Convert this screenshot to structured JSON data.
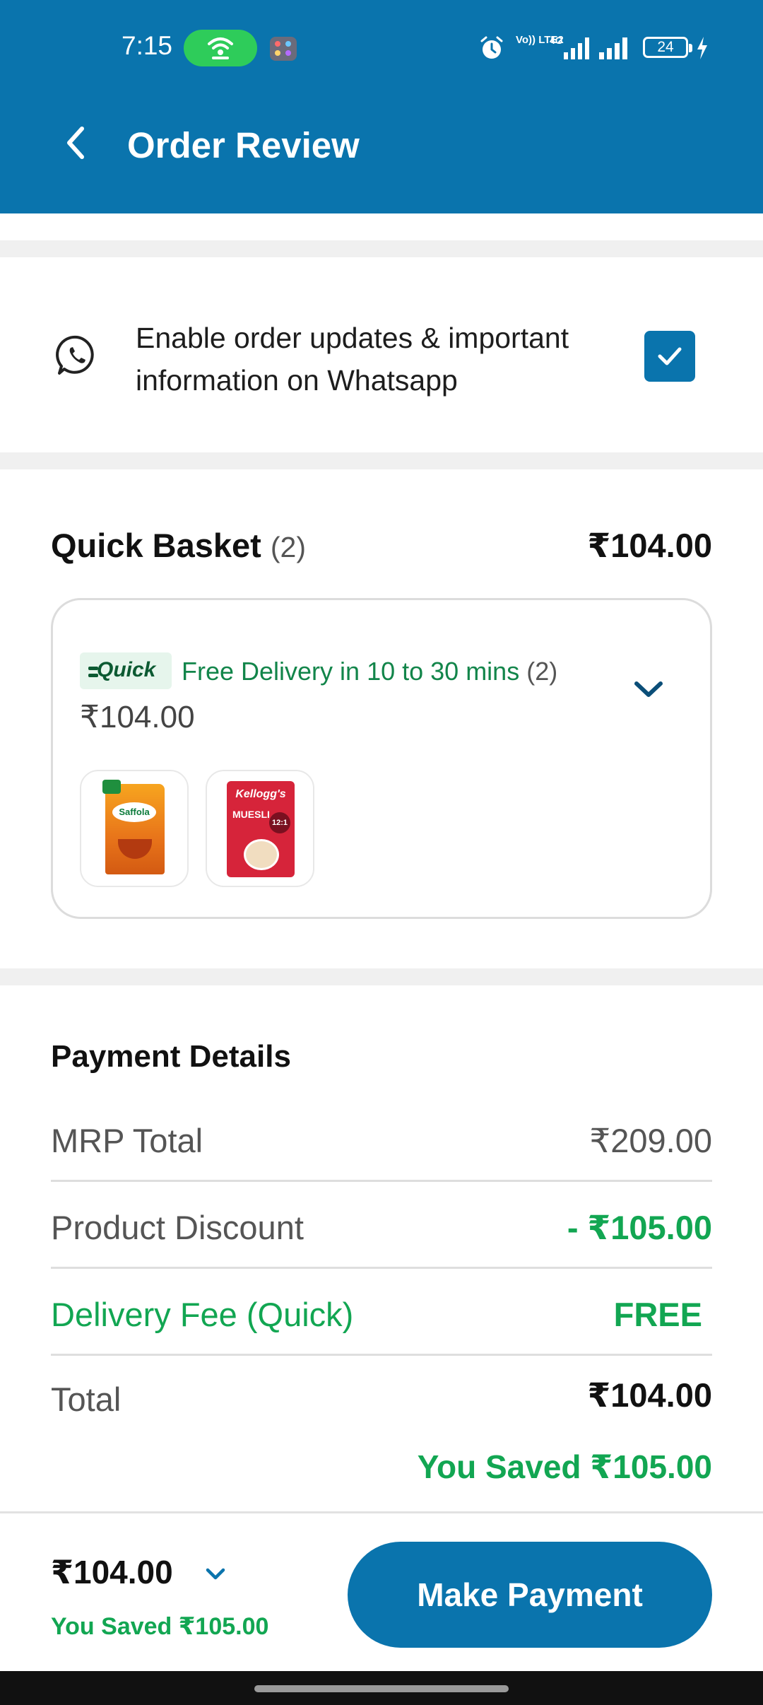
{
  "status_bar": {
    "time": "7:15",
    "network_label": "Vo)) LTE2",
    "signal_label": "4G",
    "battery": "24"
  },
  "header": {
    "title": "Order Review",
    "background": "#0a74ad"
  },
  "whatsapp": {
    "text": "Enable order updates & important information on Whatsapp",
    "checked": true
  },
  "basket": {
    "title": "Quick Basket",
    "count": "(2)",
    "total": "₹104.00",
    "badge_label": "Quick",
    "delivery_text": "Free Delivery in 10 to 30 mins",
    "delivery_count": "(2)",
    "subtotal": "₹104.00",
    "items": [
      {
        "name": "saffola-masala-oats",
        "brand": "Saffola",
        "icon": "oats-pack"
      },
      {
        "name": "kelloggs-muesli",
        "brand": "Kellogg's",
        "icon": "muesli-pack"
      }
    ]
  },
  "payment": {
    "title": "Payment Details",
    "rows": [
      {
        "label": "MRP Total",
        "value": "₹209.00"
      },
      {
        "label": "Product Discount",
        "value": "- ₹105.00"
      },
      {
        "label": "Delivery Fee (Quick)",
        "value": "FREE"
      },
      {
        "label": "Total",
        "value": "₹104.00"
      }
    ],
    "saved": "You Saved ₹105.00"
  },
  "footer": {
    "price": "₹104.00",
    "saved": "You Saved ₹105.00",
    "button_label": "Make Payment"
  },
  "colors": {
    "primary": "#0a74ad",
    "success": "#12a652",
    "quick_green": "#0c5a32"
  }
}
